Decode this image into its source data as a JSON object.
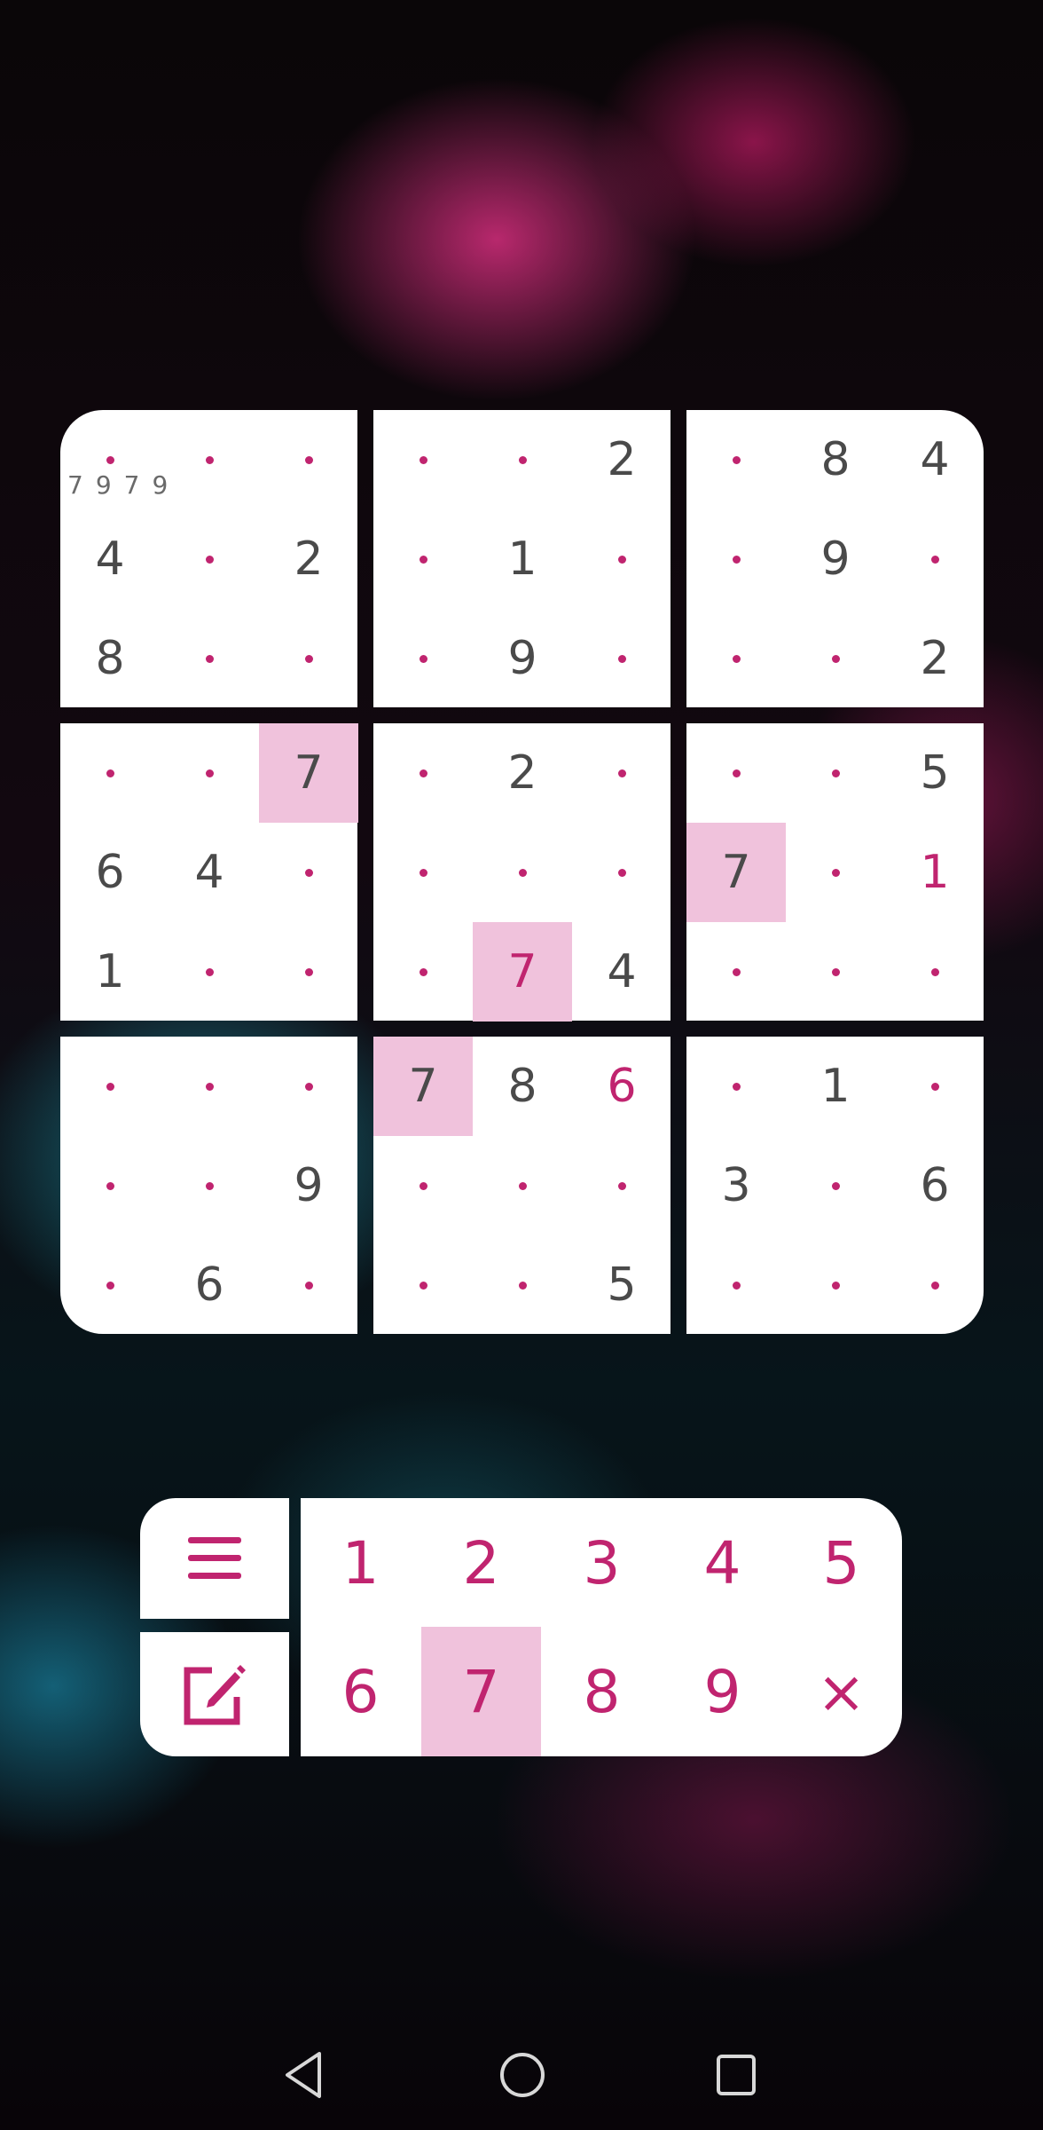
{
  "board": {
    "boxes": [
      {
        "corner": "tl",
        "cells": [
          "",
          "",
          "",
          "4",
          "",
          "2",
          "8",
          "",
          ""
        ],
        "notes": [
          "7",
          "9",
          "7",
          "9"
        ]
      },
      {
        "corner": "",
        "cells": [
          "",
          "",
          "2",
          "",
          "1",
          "",
          "",
          "9",
          ""
        ]
      },
      {
        "corner": "tr",
        "cells": [
          "",
          "8",
          "4",
          "",
          "9",
          "",
          "",
          "",
          "2"
        ]
      },
      {
        "corner": "",
        "cells": [
          "",
          "",
          "7",
          "6",
          "4",
          "",
          "1",
          "",
          ""
        ]
      },
      {
        "corner": "",
        "cells": [
          "",
          "2",
          "",
          "",
          "",
          "",
          "",
          "7",
          "4"
        ]
      },
      {
        "corner": "",
        "cells": [
          "",
          "",
          "5",
          "7",
          "",
          "1",
          "",
          "",
          ""
        ]
      },
      {
        "corner": "bl",
        "cells": [
          "",
          "",
          "",
          "",
          "",
          "9",
          "",
          "6",
          ""
        ]
      },
      {
        "corner": "",
        "cells": [
          "7",
          "8",
          "6",
          "",
          "",
          "",
          "",
          "",
          "5"
        ]
      },
      {
        "corner": "br",
        "cells": [
          "",
          "1",
          "",
          "3",
          "",
          "6",
          "",
          "",
          ""
        ]
      }
    ],
    "highlighted": [
      [
        3,
        2
      ],
      [
        4,
        7
      ],
      [
        5,
        3
      ],
      [
        7,
        0
      ]
    ],
    "user_entered": [
      [
        4,
        7
      ],
      [
        5,
        5
      ],
      [
        7,
        2
      ]
    ]
  },
  "controls": {
    "menu_icon": "hamburger-menu-icon",
    "notes_icon": "pencil-edit-icon",
    "keys": [
      "1",
      "2",
      "3",
      "4",
      "5",
      "6",
      "7",
      "8",
      "9",
      "×"
    ],
    "selected_key": "7",
    "accent_color": "#c0246f",
    "highlight_color": "#f0c2dc"
  },
  "navbar": {
    "icons": [
      "back-triangle-icon",
      "home-circle-icon",
      "recents-square-icon"
    ]
  }
}
